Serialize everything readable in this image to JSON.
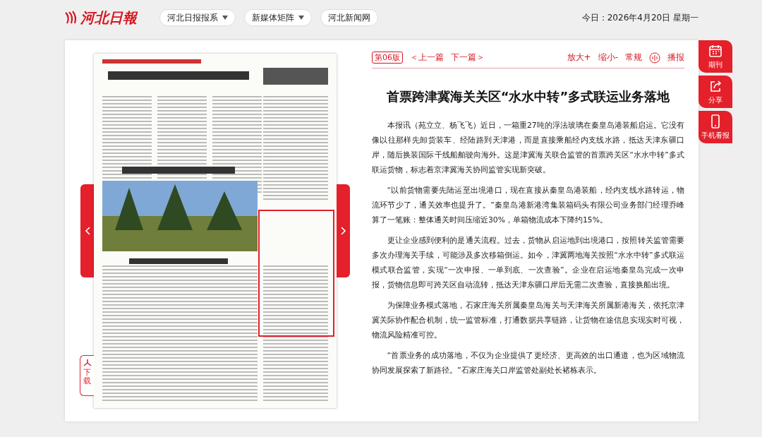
{
  "header": {
    "logo": "河北日報",
    "nav": [
      {
        "label": "河北日报报系",
        "dropdown": true
      },
      {
        "label": "新媒体矩阵",
        "dropdown": true
      },
      {
        "label": "河北新闻网",
        "dropdown": false
      }
    ],
    "date": "今日：2026年4月20日 星期一"
  },
  "page_viewer": {
    "download": "下载"
  },
  "article": {
    "edition": "第06版",
    "prev": "＜上一篇",
    "next": "下一篇＞",
    "tools": [
      "放大+",
      "缩小-",
      "常规"
    ],
    "play": "播报",
    "title": "首票跨津冀海关关区“水水中转”多式联运业务落地",
    "paragraphs": [
      "本报讯（苑立立、杨飞飞）近日，一箱重27吨的浮法玻璃在秦皇岛港装船启运。它没有像以往那样先卸货装车、经陆路到天津港，而是直接乘船经内支线水路，抵达天津东疆口岸，随后换装国际干线船舶驶向海外。这是津冀海关联合监管的首票跨关区“水水中转”多式联运货物，标志着京津冀海关协同监管实现新突破。",
      "“以前货物需要先陆运至出境港口，现在直接从秦皇岛港装船，经内支线水路转运，物流环节少了，通关效率也提升了。”秦皇岛港新港湾集装箱码头有限公司业务部门经理乔峰算了一笔账：整体通关时间压缩近30%，单箱物流成本下降约15%。",
      "更让企业感到便利的是通关流程。过去，货物从启运地到出境港口，按照转关监管需要多次办理海关手续，可能涉及多次移箱倒运。如今，津冀两地海关按照“水水中转”多式联运模式联合监管，实现“一次申报、一单到底、一次查验”。企业在启运地秦皇岛完成一次申报，货物信息即可跨关区自动流转，抵达天津东疆口岸后无需二次查验，直接换船出境。",
      "为保障业务模式落地，石家庄海关所属秦皇岛海关与天津海关所属新港海关，依托京津冀关际协作配合机制，统一监管标准，打通数据共享链路，让货物在途信息实现实时可视，物流风险精准可控。",
      "“首票业务的成功落地，不仅为企业提供了更经济、更高效的出口通道，也为区域物流协同发展探索了新路径。”石家庄海关口岸监管处副处长褚栋表示。"
    ]
  },
  "side_menu": [
    {
      "kind": "calendar",
      "label": "期刊"
    },
    {
      "kind": "share",
      "label": "分享"
    },
    {
      "kind": "phone",
      "label": "手机看报"
    }
  ]
}
